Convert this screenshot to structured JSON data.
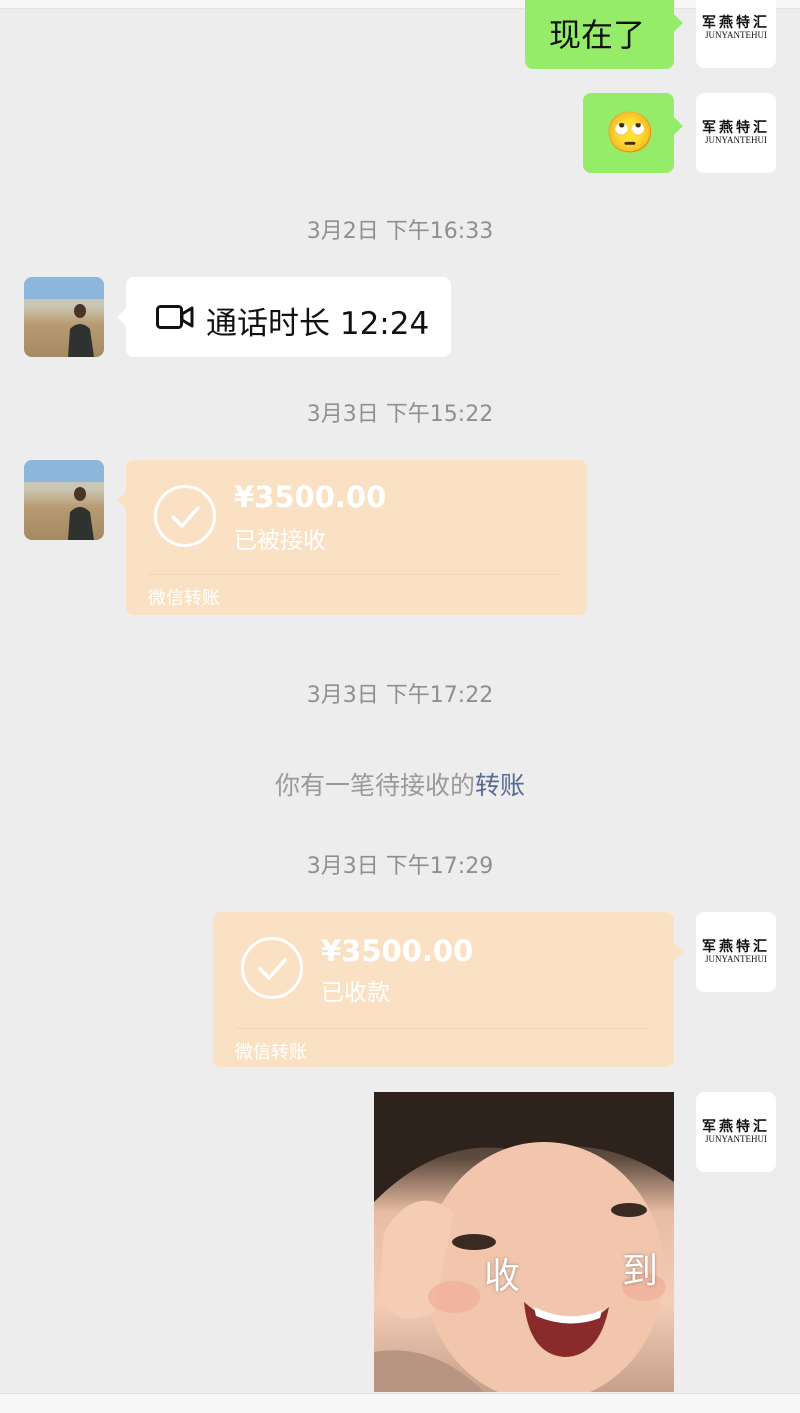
{
  "brand_avatar": {
    "cn": "军燕特汇",
    "en": "JUNYANTEHUI"
  },
  "messages": {
    "m1_text": "现在了",
    "m2_emoji": "🙄",
    "ts1": "3月2日 下午16:33",
    "call_text": "通话时长 12:24",
    "ts2": "3月3日 下午15:22",
    "transfer1": {
      "amount": "¥3500.00",
      "status": "已被接收",
      "footer": "微信转账"
    },
    "ts3": "3月3日 下午17:22",
    "pending": {
      "text": "你有一笔待接收的",
      "link": "转账"
    },
    "ts4": "3月3日 下午17:29",
    "transfer2": {
      "amount": "¥3500.00",
      "status": "已收款",
      "footer": "微信转账"
    },
    "sticker": {
      "left_char": "收",
      "right_char": "到"
    }
  },
  "colors": {
    "background": "#ededed",
    "sent_bubble": "#95ec69",
    "transfer_bubble": "#fbe1c3",
    "link": "#576b95"
  },
  "icons": {
    "call": "video-camera-icon",
    "transfer": "check-circle-icon"
  }
}
